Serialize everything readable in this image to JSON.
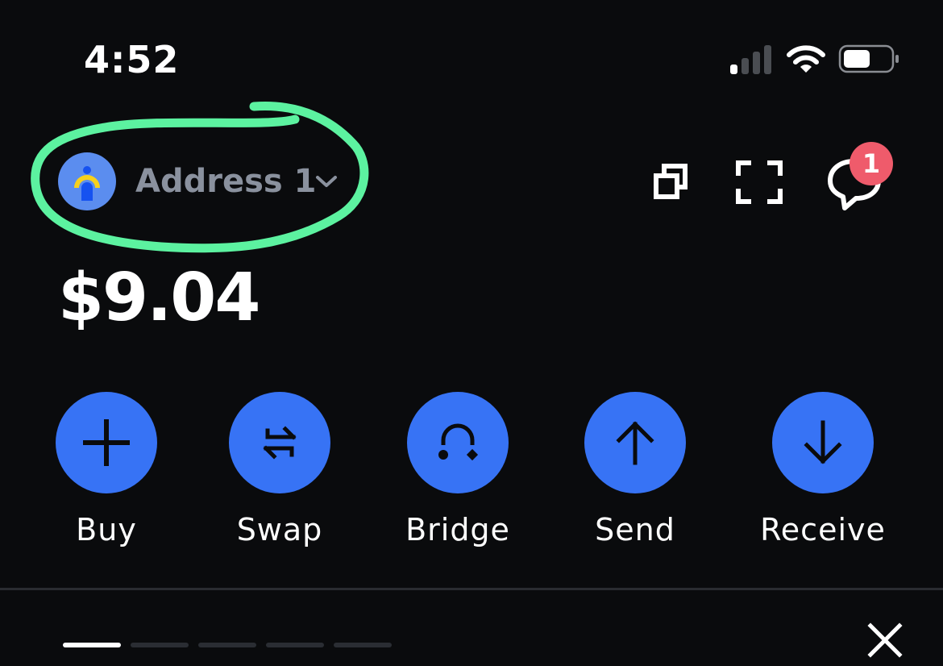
{
  "status_bar": {
    "time": "4:52",
    "icons": [
      "cellular-signal-icon",
      "wifi-icon",
      "battery-icon"
    ]
  },
  "account": {
    "name": "Address 1",
    "avatar_icon": "person-avatar-icon",
    "avatar_color": "#5b8def",
    "name_color": "#8a919e"
  },
  "header_actions": {
    "copy_icon": "copy-icon",
    "scan_icon": "qr-scan-icon",
    "messages_icon": "chat-bubble-icon",
    "messages_badge": "1",
    "badge_color": "#ef5b6b"
  },
  "balance": {
    "amount": "$9.04"
  },
  "actions": [
    {
      "label": "Buy",
      "icon": "plus-icon"
    },
    {
      "label": "Swap",
      "icon": "swap-arrows-icon"
    },
    {
      "label": "Bridge",
      "icon": "bridge-icon"
    },
    {
      "label": "Send",
      "icon": "arrow-up-icon"
    },
    {
      "label": "Receive",
      "icon": "arrow-down-icon"
    }
  ],
  "colors": {
    "background": "#0a0b0d",
    "accent": "#3773f5",
    "annotation": "#5cf2a0"
  },
  "carousel": {
    "page_count": 5,
    "active_page": 1,
    "close_icon": "close-icon"
  }
}
